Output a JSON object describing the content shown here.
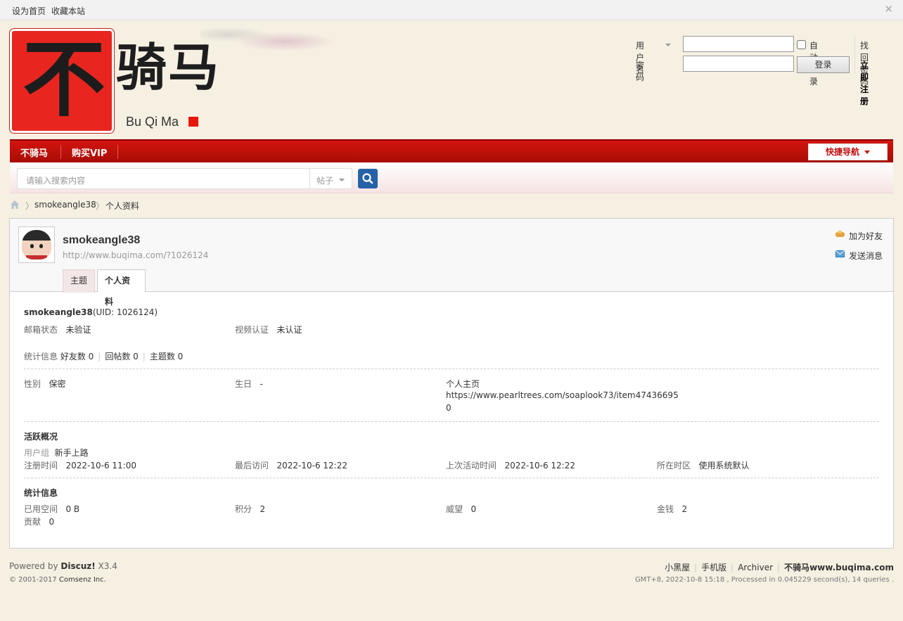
{
  "topbar": {
    "set_home": "设为首页",
    "bookmark": "收藏本站",
    "close_glyph": "✕"
  },
  "logo": {
    "glyph": "不",
    "text": "骑马",
    "subtitle": "Bu Qi Ma"
  },
  "login": {
    "username_label": "用户名",
    "password_label": "密码",
    "auto_login": "自动登录",
    "forgot_password": "找回密码",
    "login_button": "登录",
    "register": "立即注册",
    "username_value": "",
    "password_value": ""
  },
  "nav": {
    "items": [
      "不骑马",
      "购买VIP"
    ],
    "quick_nav": "快捷导航"
  },
  "search": {
    "placeholder": "请输入搜索内容",
    "type": "帖子"
  },
  "breadcrumb": {
    "user": "smokeangle38",
    "page": "个人资料",
    "sep": "〉"
  },
  "profile": {
    "username": "smokeangle38",
    "url": "http://www.buqima.com/?1026124",
    "add_friend": "加为好友",
    "send_message": "发送消息",
    "tabs": [
      "主题",
      "个人资料"
    ],
    "uid_text": "(UID: 1026124)",
    "email_status_label": "邮箱状态",
    "email_status": "未验证",
    "video_label": "视频认证",
    "video_status": "未认证",
    "stats_label": "统计信息",
    "friends": "好友数 0",
    "replies": "回帖数 0",
    "threads": "主题数 0",
    "gender_label": "性别",
    "gender": "保密",
    "birthday_label": "生日",
    "birthday": "-",
    "homepage_label": "个人主页",
    "homepage_line1": "https://www.pearltrees.com/soaplook73/item47436695",
    "homepage_line2": "0",
    "activity_title": "活跃概况",
    "group_label": "用户组",
    "group": "新手上路",
    "reg_label": "注册时间",
    "reg_time": "2022-10-6 11:00",
    "last_visit_label": "最后访问",
    "last_visit": "2022-10-6 12:22",
    "last_active_label": "上次活动时间",
    "last_active": "2022-10-6 12:22",
    "tz_label": "所在时区",
    "tz": "使用系统默认",
    "stats_title": "统计信息",
    "space_label": "已用空间",
    "space": "0 B",
    "points_label": "积分",
    "points": "2",
    "prestige_label": "威望",
    "prestige": "0",
    "money_label": "金钱",
    "money": "2",
    "contrib_label": "贡献",
    "contrib": "0"
  },
  "footer": {
    "powered_prefix": "Powered by ",
    "powered_brand": "Discuz!",
    "powered_ver": " X3.4",
    "copyright_prefix": "© 2001-2017 ",
    "copyright_company": "Comsenz Inc.",
    "links": [
      "小黑屋",
      "手机版",
      "Archiver"
    ],
    "site": "不骑马www.buqima.com",
    "stats": "GMT+8, 2022-10-8 15:18 , Processed in 0.045229 second(s), 14 queries ."
  },
  "colors": {
    "brand_red": "#c30e0e",
    "search_button": "#2563a8"
  }
}
